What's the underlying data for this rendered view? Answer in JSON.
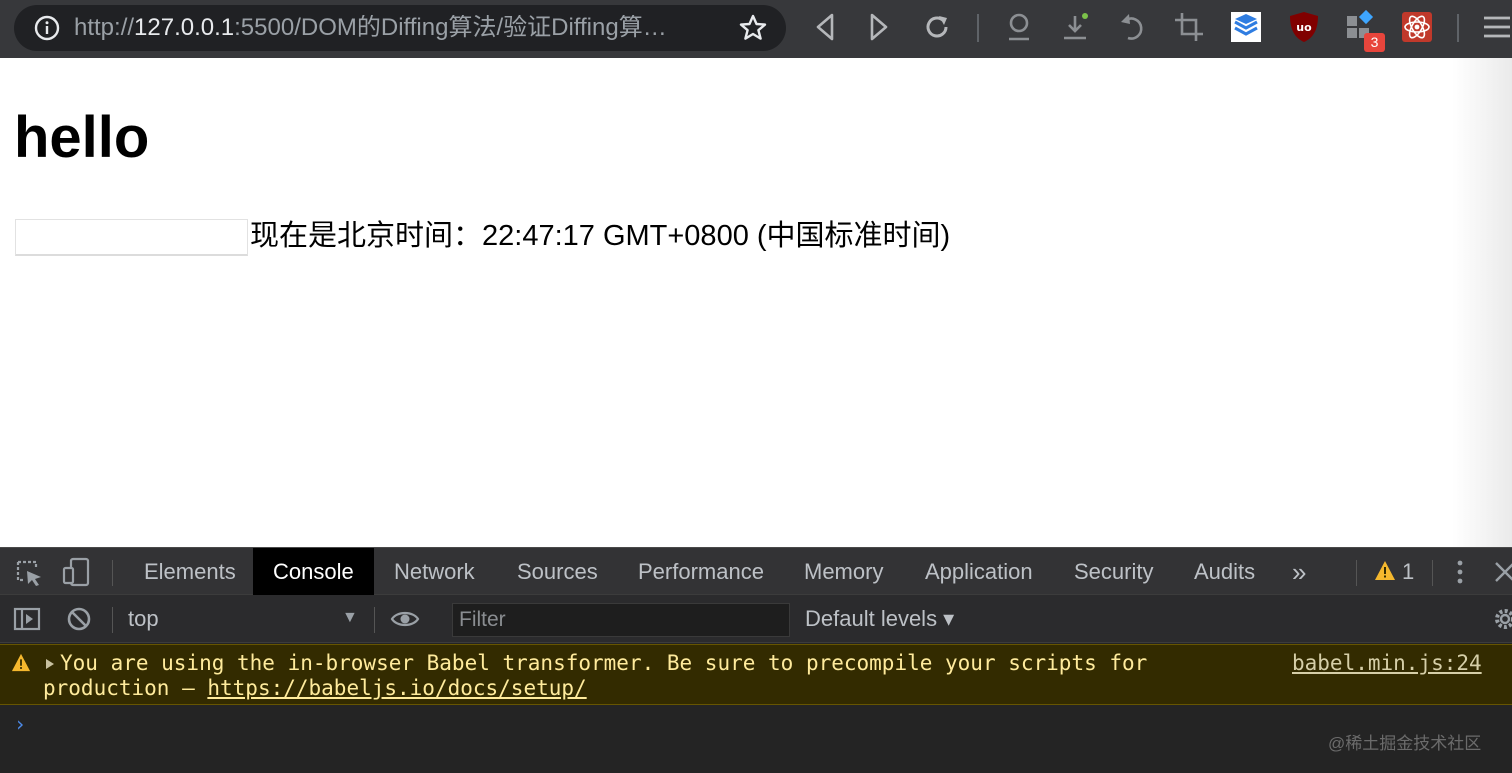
{
  "browser": {
    "url_prefix": "http://",
    "url_host": "127.0.0.1",
    "url_rest": ":5500/DOM的Diffing算法/验证Diffing算…",
    "extension_badge": "3"
  },
  "page": {
    "heading": "hello",
    "input_value": "",
    "time_text": "现在是北京时间：22:47:17 GMT+0800 (中国标准时间)"
  },
  "devtools": {
    "tabs": [
      "Elements",
      "Console",
      "Network",
      "Sources",
      "Performance",
      "Memory",
      "Application",
      "Security",
      "Audits"
    ],
    "active_tab": "Console",
    "more_tabs": "»",
    "warning_count": "1",
    "context": "top",
    "filter_placeholder": "Filter",
    "levels": "Default levels ▾",
    "console_messages": [
      {
        "level": "warning",
        "text": "You are using the in-browser Babel transformer. Be sure to precompile your scripts for production — ",
        "link": "https://babeljs.io/docs/setup/",
        "source": "babel.min.js:24"
      }
    ],
    "prompt": "›"
  },
  "watermark": "@稀土掘金技术社区",
  "colors": {
    "toolbar": "#37383b",
    "devtools_bg": "#242424",
    "warning_bg": "#332b00",
    "warning_text": "#ffeb9c",
    "prompt_blue": "#4c8ae8"
  }
}
